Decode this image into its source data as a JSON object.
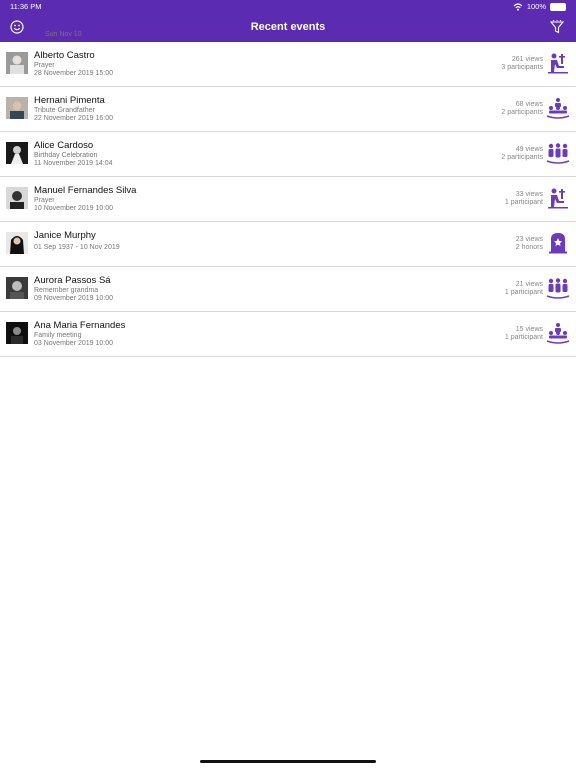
{
  "status_bar": {
    "time": "11:36 PM",
    "date": "Sun Nov 10",
    "battery": "100%"
  },
  "navbar": {
    "title": "Recent events",
    "left_icon": "emoji-icon",
    "right_icon": "filter-icon"
  },
  "colors": {
    "accent": "#5b2bb1",
    "icon": "#6a3bc1"
  },
  "events": [
    {
      "name": "Alberto Castro",
      "subtitle": "Prayer",
      "date": "28 November 2019 15:00",
      "views": "261 views",
      "participants": "3 participants",
      "icon": "prayer-icon"
    },
    {
      "name": "Hernani Pimenta",
      "subtitle": "Tribute Grandfather",
      "date": "22 November 2019 16:00",
      "views": "68 views",
      "participants": "2 participants",
      "icon": "tribute-icon"
    },
    {
      "name": "Alice Cardoso",
      "subtitle": "Birthday Celebration",
      "date": "11 November 2019 14:04",
      "views": "49 views",
      "participants": "2 participants",
      "icon": "group-icon"
    },
    {
      "name": "Manuel Fernandes Silva",
      "subtitle": "Prayer",
      "date": "10 November 2019 10:00",
      "views": "33 views",
      "participants": "1 participant",
      "icon": "prayer-icon"
    },
    {
      "name": "Janice Murphy",
      "subtitle": "",
      "date": "01 Sep 1937 - 10 Nov 2019",
      "views": "23 views",
      "participants": "2 honors",
      "icon": "tombstone-icon"
    },
    {
      "name": "Aurora Passos Sá",
      "subtitle": "Remember grandma",
      "date": "09 November 2019 10:00",
      "views": "21 views",
      "participants": "1 participant",
      "icon": "group-icon"
    },
    {
      "name": "Ana Maria Fernandes",
      "subtitle": "Family meeting",
      "date": "03 November 2019 10:00",
      "views": "15 views",
      "participants": "1 participant",
      "icon": "tribute-icon"
    }
  ]
}
